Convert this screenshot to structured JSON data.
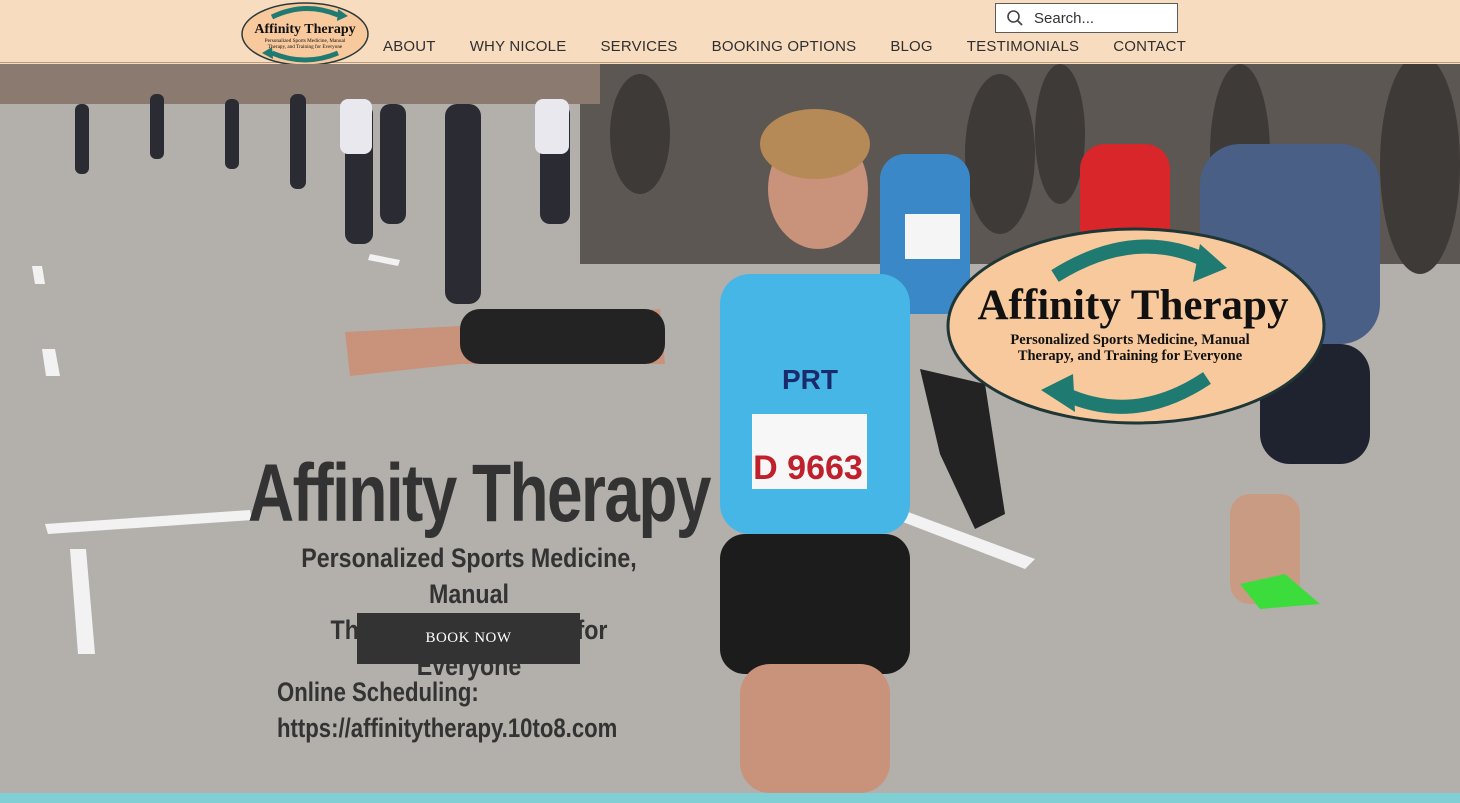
{
  "brand": {
    "name": "Affinity Therapy",
    "tagline_line1": "Personalized Sports Medicine, Manual",
    "tagline_line2": "Therapy, and Training for Everyone"
  },
  "nav": {
    "items": [
      {
        "label": "ABOUT"
      },
      {
        "label": "WHY NICOLE"
      },
      {
        "label": "SERVICES"
      },
      {
        "label": "BOOKING OPTIONS"
      },
      {
        "label": "BLOG"
      },
      {
        "label": "TESTIMONIALS"
      },
      {
        "label": "CONTACT"
      }
    ]
  },
  "search": {
    "placeholder": "Search...",
    "value": ""
  },
  "hero": {
    "title": "Affinity Therapy",
    "subtitle_line1": "Personalized Sports Medicine, Manual",
    "subtitle_line2": "Therapy, and Training for Everyone",
    "book_label": "BOOK NOW",
    "scheduling_label": "Online Scheduling:",
    "scheduling_url": "https://affinitytherapy.10to8.com",
    "background_icon": "marathon-runners-photo"
  },
  "colors": {
    "header_bg": "#f8dcc0",
    "logo_teal": "#1f7a72",
    "logo_peach": "#f7c99c",
    "text_dark": "#333333",
    "button_bg": "#333333",
    "strip": "#7fcfd4"
  }
}
